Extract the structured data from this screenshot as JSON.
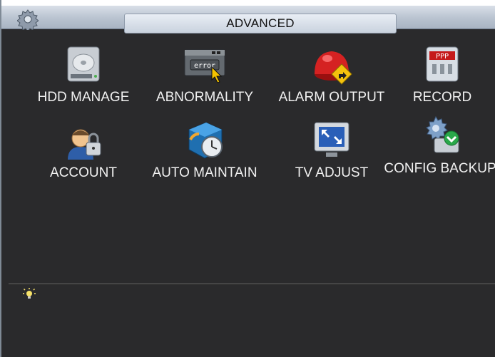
{
  "window": {
    "title": "ADVANCED"
  },
  "menu": {
    "items": [
      {
        "label": "HDD MANAGE",
        "icon": "hdd-icon"
      },
      {
        "label": "ABNORMALITY",
        "icon": "error-icon",
        "icon_text": "error"
      },
      {
        "label": "ALARM OUTPUT",
        "icon": "alarm-output-icon"
      },
      {
        "label": "RECORD",
        "icon": "record-icon"
      },
      {
        "label": "ACCOUNT",
        "icon": "account-icon"
      },
      {
        "label": "AUTO MAINTAIN",
        "icon": "auto-maintain-icon"
      },
      {
        "label": "TV ADJUST",
        "icon": "tv-adjust-icon"
      },
      {
        "label": "CONFIG BACKUP",
        "icon": "config-backup-icon"
      }
    ]
  },
  "colors": {
    "background": "#2a2a2c",
    "text": "#f1f1f1",
    "title_bar": "#b9c3d0"
  }
}
